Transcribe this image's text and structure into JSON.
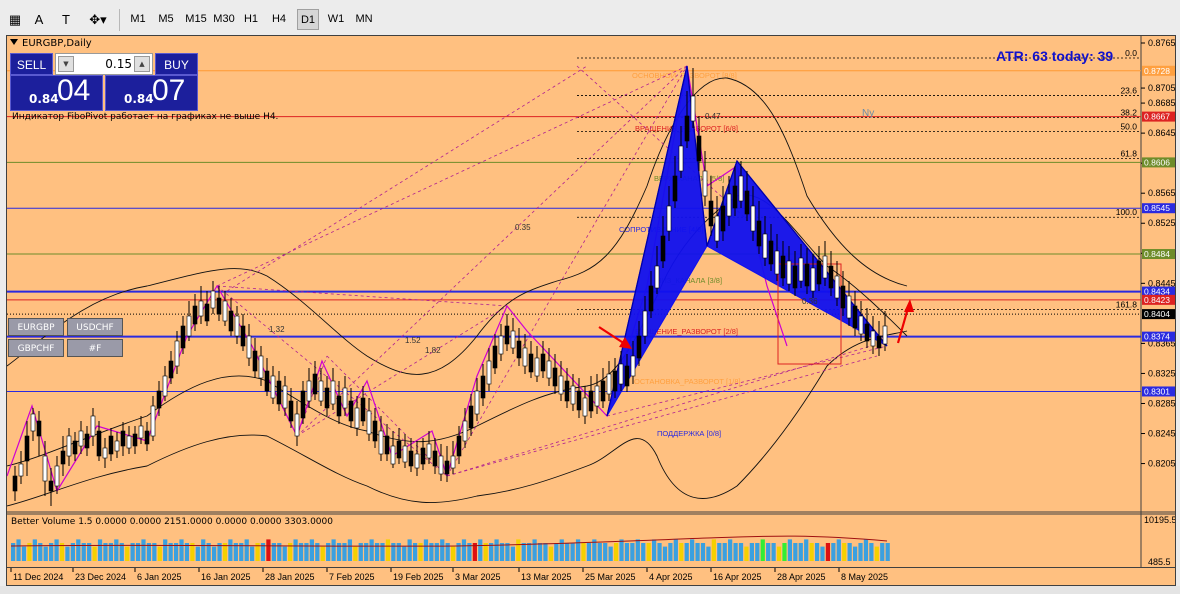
{
  "toolbar": {
    "icons": [
      "grid-icon",
      "text-icon",
      "text-frame-icon",
      "shapes-icon"
    ],
    "timeframes": [
      "M1",
      "M5",
      "M15",
      "M30",
      "H1",
      "H4",
      "D1",
      "W1",
      "MN"
    ],
    "active_timeframe": "D1"
  },
  "chart": {
    "title": "EURGBP,Daily",
    "atr_label": "ATR: 63  today: 39",
    "note": "Индикатор FiboPivot работает на графиках не выше H4.",
    "symbols": [
      "EURGBP",
      "USDCHF",
      "GBPCHF",
      "#F"
    ],
    "trade_panel": {
      "sell_label": "SELL",
      "buy_label": "BUY",
      "lot": "0.15",
      "bid_small": "0.84",
      "bid_big": "04",
      "ask_small": "0.84",
      "ask_big": "07"
    },
    "price_labels": [
      "0.8765",
      "0.8705",
      "0.8685",
      "0.8645",
      "0.8605",
      "0.8565",
      "0.8525",
      "0.8485",
      "0.8445",
      "0.8365",
      "0.8325",
      "0.8285",
      "0.8245",
      "0.8205"
    ],
    "tagged_levels": [
      {
        "price": "0.8728",
        "bg": "#ffa040",
        "fg": "#ffffff"
      },
      {
        "price": "0.8667",
        "bg": "#dd2222",
        "fg": "#ffffff"
      },
      {
        "price": "0.8606",
        "bg": "#6e8c2a",
        "fg": "#ffffff"
      },
      {
        "price": "0.8545",
        "bg": "#2a2ae0",
        "fg": "#ffffff"
      },
      {
        "price": "0.8484",
        "bg": "#6e8c2a",
        "fg": "#ffffff"
      },
      {
        "price": "0.8434",
        "bg": "#2a2ae0",
        "fg": "#ffffff"
      },
      {
        "price": "0.8423",
        "bg": "#dd2222",
        "fg": "#ffffff"
      },
      {
        "price": "0.8404",
        "bg": "#000000",
        "fg": "#ffffff"
      },
      {
        "price": "0.8374",
        "bg": "#2a2ae0",
        "fg": "#ffffff"
      },
      {
        "price": "0.8301",
        "bg": "#2a2ae0",
        "fg": "#ffffff"
      }
    ],
    "fib_labels": [
      "0.0",
      "23.6",
      "38.2",
      "50.0",
      "61.8",
      "100.0",
      "161.8"
    ],
    "murrey_labels": [
      {
        "text": "ОСНОВНОЙ_РАЗВОРОТ [8/8]",
        "color": "#ffa040"
      },
      {
        "text": "ВРАЩЕНИЕ_РАЗВОРОТ [6/8]",
        "color": "#dd2222"
      },
      {
        "text": "ВЕРХ_КАНАЛА [5/8]",
        "color": "#6e8c2a"
      },
      {
        "text": "СОПРОТИВЛЕНИЕ [4/8]",
        "color": "#2a2ae0"
      },
      {
        "text": "НИЗ_КАНАЛА [3/8]",
        "color": "#6e8c2a"
      },
      {
        "text": "ВРАЩЕНИЕ_РАЗВОРОТ [2/8]",
        "color": "#dd2222"
      },
      {
        "text": "ОСТАНОВКА_РАЗВОРОТ [1/8]",
        "color": "#ffa040"
      },
      {
        "text": "ПОДДЕРЖКА [0/8]",
        "color": "#2a2ae0"
      }
    ],
    "pattern_numbers": [
      "0.47",
      "0.35",
      "1.52",
      "1.82",
      "0.36",
      "1.32"
    ],
    "annotation_ny": "Ny"
  },
  "volume": {
    "title": "Better Volume 1.5 0.0000 0.0000 2151.0000 0.0000 0.0000 3303.0000",
    "max_label": "10195.5",
    "min_label": "485.5",
    "values": [
      5,
      6,
      4,
      5,
      6,
      5,
      4,
      5,
      6,
      5,
      4,
      5,
      6,
      5,
      5,
      4,
      6,
      5,
      5,
      6,
      5,
      4,
      5,
      5,
      6,
      5,
      5,
      4,
      6,
      5,
      5,
      6,
      5,
      5,
      4,
      6,
      5,
      4,
      5,
      5,
      6,
      5,
      5,
      6,
      4,
      5,
      5,
      6,
      5,
      5,
      4,
      5,
      6,
      5,
      5,
      6,
      5,
      4,
      5,
      6,
      5,
      5,
      6,
      4,
      5,
      5,
      6,
      5,
      5,
      6,
      5,
      5,
      4,
      6,
      5,
      5,
      6,
      5,
      5,
      6,
      5,
      4,
      5,
      6,
      5,
      5,
      6,
      5,
      5,
      6,
      5,
      5,
      4,
      6,
      5,
      5,
      6,
      5,
      5,
      4,
      5,
      6,
      5,
      5,
      6,
      5,
      5,
      6,
      5,
      5,
      4,
      5,
      6,
      5,
      5,
      6,
      5,
      5,
      6,
      5,
      4,
      5,
      6,
      5,
      5,
      6,
      5,
      5,
      4,
      6,
      5,
      5,
      6,
      5,
      5,
      4,
      5,
      5,
      6,
      5,
      5,
      4,
      5,
      6,
      5,
      5,
      6,
      5,
      5,
      4,
      5,
      5,
      6,
      5,
      5,
      4,
      5,
      6,
      5,
      4,
      5,
      5
    ]
  },
  "xaxis_labels": [
    "11 Dec 2024",
    "23 Dec 2024",
    "6 Jan 2025",
    "16 Jan 2025",
    "28 Jan 2025",
    "7 Feb 2025",
    "19 Feb 2025",
    "3 Mar 2025",
    "13 Mar 2025",
    "25 Mar 2025",
    "4 Apr 2025",
    "16 Apr 2025",
    "28 Apr 2025",
    "8 May 2025"
  ]
}
